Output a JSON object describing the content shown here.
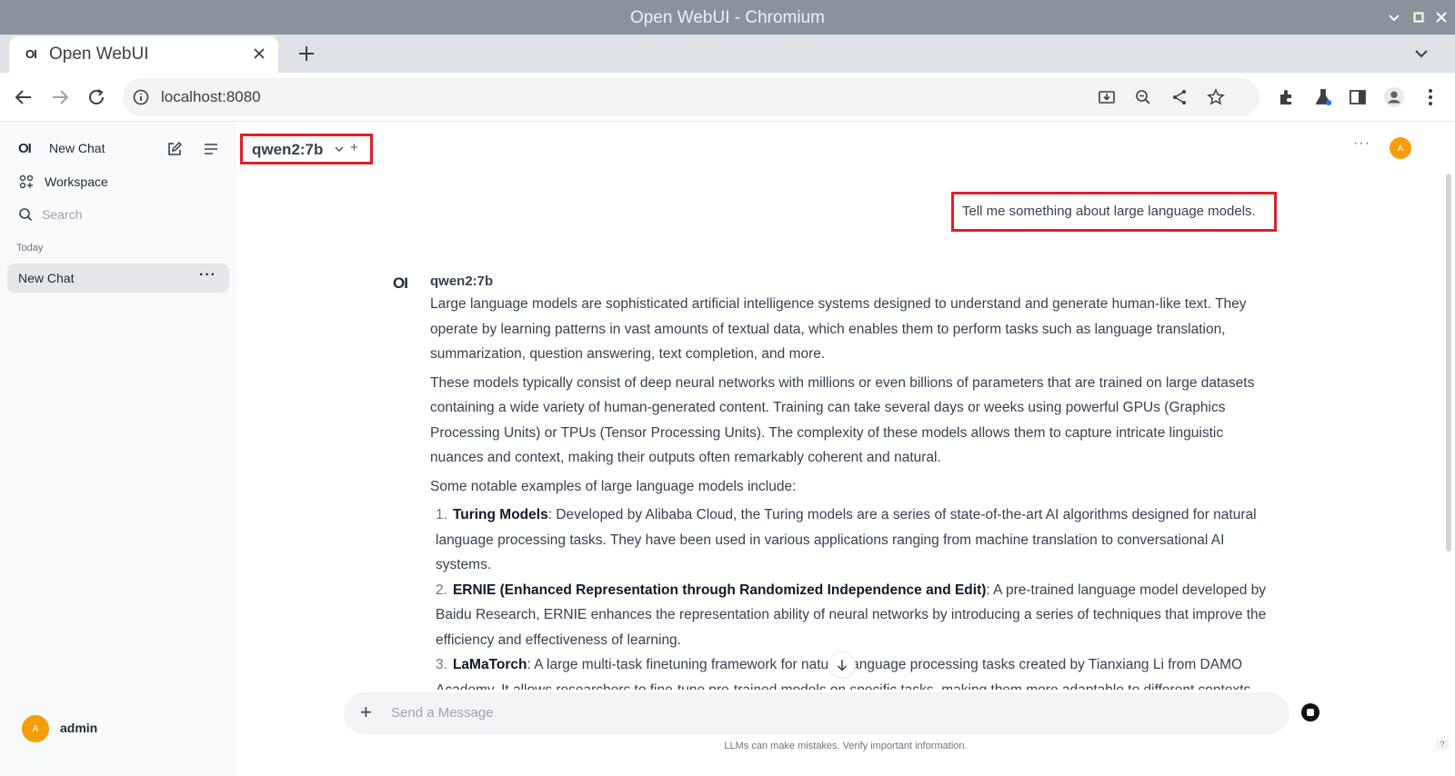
{
  "window": {
    "title": "Open WebUI - Chromium"
  },
  "tab": {
    "title": "Open WebUI",
    "favicon_text": "OI"
  },
  "toolbar": {
    "url": "localhost:8080"
  },
  "sidebar": {
    "logo_text": "OI",
    "new_chat": "New Chat",
    "workspace": "Workspace",
    "search_placeholder": "Search",
    "section_today": "Today",
    "chats": [
      {
        "label": "New Chat"
      }
    ],
    "user": {
      "name": "admin",
      "initial": "A"
    }
  },
  "header": {
    "model": "qwen2:7b",
    "add": "+",
    "menu": "···",
    "avatar_initial": "A"
  },
  "conversation": {
    "user_message": "Tell me something about large language models.",
    "assistant": {
      "logo_text": "OI",
      "model": "qwen2:7b",
      "paragraphs": [
        "Large language models are sophisticated artificial intelligence systems designed to understand and generate human-like text. They operate by learning patterns in vast amounts of textual data, which enables them to perform tasks such as language translation, summarization, question answering, text completion, and more.",
        "These models typically consist of deep neural networks with millions or even billions of parameters that are trained on large datasets containing a wide variety of human-generated content. Training can take several days or weeks using powerful GPUs (Graphics Processing Units) or TPUs (Tensor Processing Units). The complexity of these models allows them to capture intricate linguistic nuances and context, making their outputs often remarkably coherent and natural.",
        "Some notable examples of large language models include:"
      ],
      "list": [
        {
          "num": "1.",
          "term": "Turing Models",
          "text": ": Developed by Alibaba Cloud, the Turing models are a series of state-of-the-art AI algorithms designed for natural language processing tasks. They have been used in various applications ranging from machine translation to conversational AI systems."
        },
        {
          "num": "2.",
          "term": "ERNIE (Enhanced Representation through Randomized Independence and Edit)",
          "text": ": A pre-trained language model developed by Baidu Research, ERNIE enhances the representation ability of neural networks by introducing a series of techniques that improve the efficiency and effectiveness of learning."
        },
        {
          "num": "3.",
          "term": "LaMaTorch",
          "text": ": A large multi-task finetuning framework for natural language processing tasks created by Tianxiang Li from DAMO Academy. It allows researchers to fine-tune pre-trained models on specific tasks, making them more adaptable to different contexts."
        }
      ]
    }
  },
  "composer": {
    "placeholder": "Send a Message",
    "add": "+"
  },
  "footer": {
    "disclaimer": "LLMs can make mistakes. Verify important information.",
    "help": "?"
  },
  "colors": {
    "highlight": "#e11d2b",
    "avatar": "#f59e0b",
    "titlebar": "#8a939c"
  }
}
